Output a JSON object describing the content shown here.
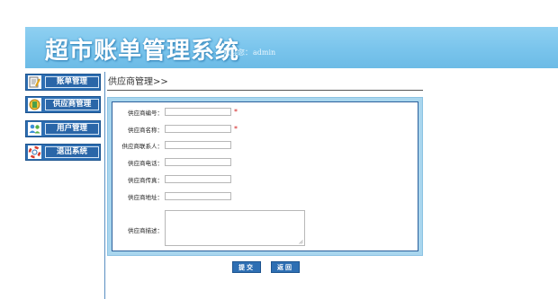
{
  "header": {
    "title": "超市账单管理系统",
    "welcome_prefix": "欢迎您：",
    "username": "admin"
  },
  "sidebar": {
    "items": [
      {
        "label": "账单管理",
        "icon": "notepad-icon"
      },
      {
        "label": "供应商管理",
        "icon": "supplier-icon"
      },
      {
        "label": "用户管理",
        "icon": "users-icon"
      },
      {
        "label": "退出系统",
        "icon": "lifebuoy-icon"
      }
    ]
  },
  "page": {
    "title": "供应商管理>>"
  },
  "form": {
    "fields": [
      {
        "label": "供应商编号：",
        "value": "",
        "required": "*"
      },
      {
        "label": "供应商名称：",
        "value": "",
        "required": "*"
      },
      {
        "label": "供应商联系人：",
        "value": ""
      },
      {
        "label": "供应商电话：",
        "value": ""
      },
      {
        "label": "供应商传真：",
        "value": ""
      },
      {
        "label": "供应商地址：",
        "value": ""
      }
    ],
    "description": {
      "label": "供应商描述：",
      "value": ""
    }
  },
  "buttons": {
    "submit": "提交",
    "back": "返回"
  },
  "colors": {
    "header_bg": "#79c4ec",
    "nav_bg": "#2e6fb3",
    "required": "#d21b1b"
  }
}
